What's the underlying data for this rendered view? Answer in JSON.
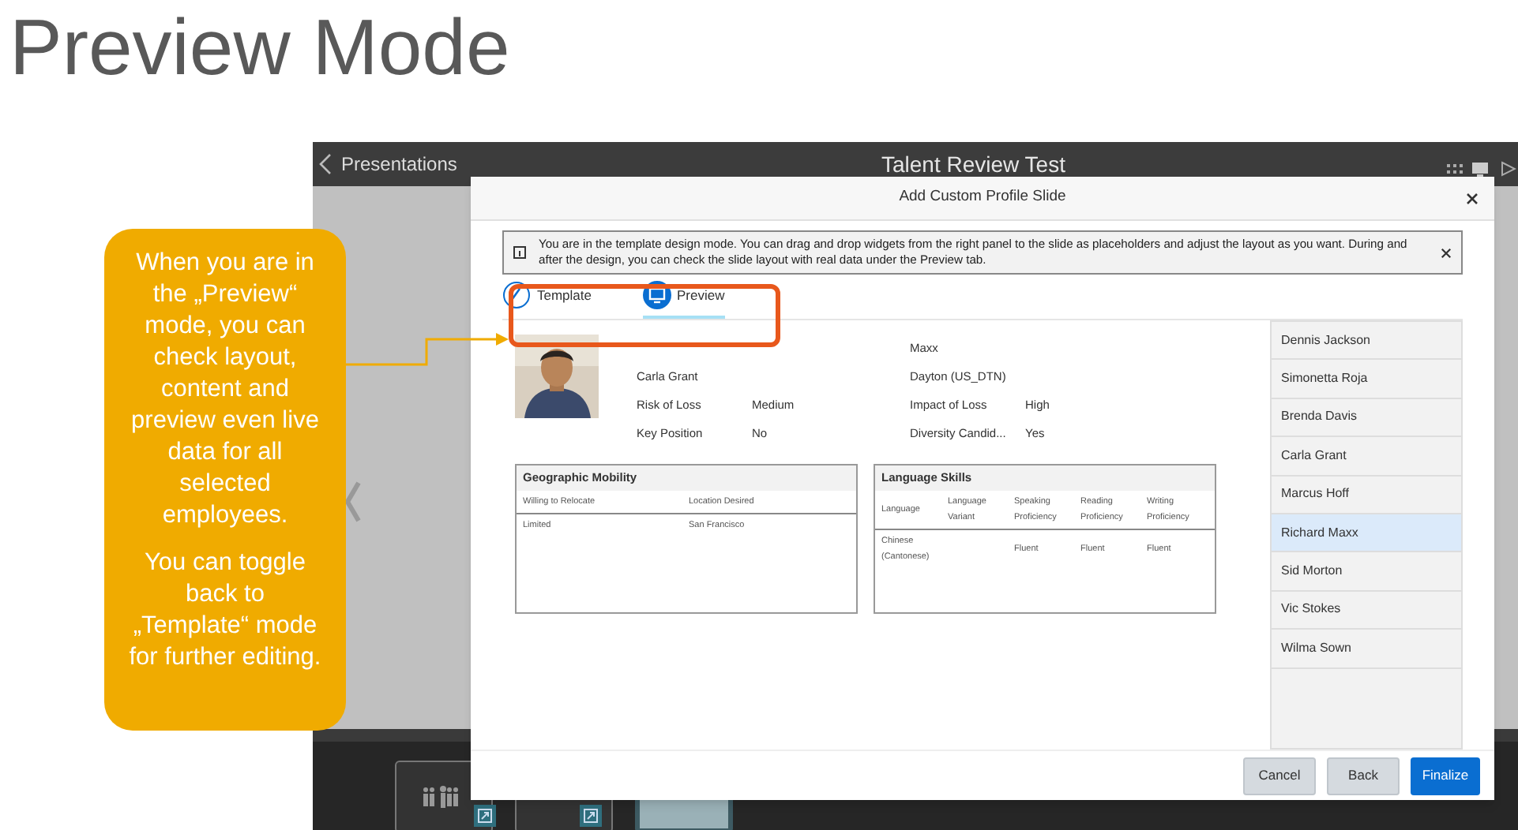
{
  "slide_title": "Preview Mode",
  "callout": {
    "paragraphs": [
      "When you are in the „Preview“ mode, you can check layout, content and preview even live data for all selected employees.",
      "You can toggle back to „Template“ mode for further editing."
    ]
  },
  "app": {
    "back_label": "Presentations",
    "title": "Talent Review Test"
  },
  "dialog": {
    "title": "Add Custom Profile Slide",
    "info": "You are in the template design mode. You can drag and drop widgets from the right panel to the slide as placeholders and adjust the layout as you want. During and after the design, you can check the slide layout with real data under the Preview tab.",
    "tabs": [
      {
        "label": "Template",
        "kind": "template",
        "selected": false
      },
      {
        "label": "Preview",
        "kind": "preview",
        "selected": true
      }
    ],
    "profile": {
      "left": [
        {
          "label": "Carla Grant"
        },
        {
          "label": "Risk of Loss",
          "value": "Medium"
        },
        {
          "label": "Key Position",
          "value": "No"
        }
      ],
      "right": [
        {
          "label": "Maxx"
        },
        {
          "label": "Dayton (US_DTN)"
        },
        {
          "label": "Impact of Loss",
          "value": "High"
        },
        {
          "label": "Diversity Candid...",
          "value": "Yes"
        }
      ]
    },
    "panels": [
      {
        "title": "Geographic Mobility",
        "columns": [
          "Willing to Relocate",
          "Location Desired"
        ],
        "rows": [
          [
            "Limited",
            "San Francisco"
          ]
        ]
      },
      {
        "title": "Language Skills",
        "columns": [
          "Language",
          "Language Variant",
          "Speaking Proficiency",
          "Reading Proficiency",
          "Writing Proficiency"
        ],
        "rows": [
          [
            "Chinese (Cantonese)",
            null,
            "Fluent",
            "Fluent",
            "Fluent"
          ]
        ]
      }
    ],
    "employees": [
      {
        "name": "Dennis Jackson",
        "selected": false
      },
      {
        "name": "Simonetta Roja",
        "selected": false
      },
      {
        "name": "Brenda Davis",
        "selected": false
      },
      {
        "name": "Carla Grant",
        "selected": false
      },
      {
        "name": "Marcus Hoff",
        "selected": false
      },
      {
        "name": "Richard Maxx",
        "selected": true
      },
      {
        "name": "Sid Morton",
        "selected": false
      },
      {
        "name": "Vic Stokes",
        "selected": false
      },
      {
        "name": "Wilma Sown",
        "selected": false
      }
    ],
    "buttons": [
      {
        "label": "Cancel",
        "kind": "secondary"
      },
      {
        "label": "Back",
        "kind": "secondary"
      },
      {
        "label": "Finalize",
        "kind": "primary"
      }
    ]
  }
}
